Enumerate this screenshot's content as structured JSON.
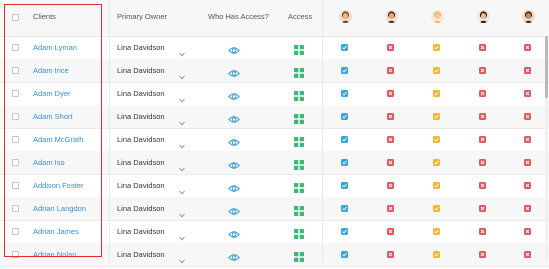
{
  "header": {
    "clients": "Clients",
    "owner": "Primary Owner",
    "who_access": "Who Has Access?",
    "access": "Access"
  },
  "avatars": [
    {
      "name": "user-avatar-1",
      "skin": "#e8b48a",
      "hair": "#6b4a2e",
      "bg": "#f2dccb"
    },
    {
      "name": "user-avatar-2",
      "skin": "#e0a985",
      "hair": "#4a2e1c",
      "bg": "#f5e0d2"
    },
    {
      "name": "user-avatar-3",
      "skin": "#f0c9a0",
      "hair": "#e1c06a",
      "bg": "#f6ead3"
    },
    {
      "name": "user-avatar-4",
      "skin": "#e7b89c",
      "hair": "#2a1c15",
      "bg": "#f6e4d9"
    },
    {
      "name": "user-avatar-5",
      "skin": "#c98b5f",
      "hair": "#3c2415",
      "bg": "#efd9c7"
    }
  ],
  "colors": {
    "check_blue": "#3aa6d8",
    "deny_red": "#e05661",
    "check_yellow": "#f2b632",
    "tiles_green": "#3cb878",
    "eye_blue": "#3a9fd0"
  },
  "rows": [
    {
      "client": "Adam Lyman",
      "owner": "Lina Davidson",
      "perms": [
        "check_blue",
        "deny_red",
        "check_yellow",
        "deny_red",
        "deny_red"
      ]
    },
    {
      "client": "Adam Ince",
      "owner": "Lina Davidson",
      "perms": [
        "check_blue",
        "deny_red",
        "check_yellow",
        "deny_red",
        "deny_red"
      ]
    },
    {
      "client": "Adam Dyer",
      "owner": "Lina Davidson",
      "perms": [
        "check_blue",
        "deny_red",
        "check_yellow",
        "deny_red",
        "deny_red"
      ]
    },
    {
      "client": "Adam Short",
      "owner": "Lina Davidson",
      "perms": [
        "check_blue",
        "deny_red",
        "check_yellow",
        "deny_red",
        "deny_red"
      ]
    },
    {
      "client": "Adam McGrath",
      "owner": "Lina Davidson",
      "perms": [
        "check_blue",
        "deny_red",
        "check_yellow",
        "deny_red",
        "deny_red"
      ]
    },
    {
      "client": "Adam Iso",
      "owner": "Lina Davidson",
      "perms": [
        "check_blue",
        "deny_red",
        "check_yellow",
        "deny_red",
        "deny_red"
      ]
    },
    {
      "client": "Addison Foster",
      "owner": "Lina Davidson",
      "perms": [
        "check_blue",
        "deny_red",
        "check_yellow",
        "deny_red",
        "deny_red"
      ]
    },
    {
      "client": "Adrian Langdon",
      "owner": "Lina Davidson",
      "perms": [
        "check_blue",
        "deny_red",
        "check_yellow",
        "deny_red",
        "deny_red"
      ]
    },
    {
      "client": "Adrian James",
      "owner": "Lina Davidson",
      "perms": [
        "check_blue",
        "deny_red",
        "check_yellow",
        "deny_red",
        "deny_red"
      ]
    },
    {
      "client": "Adrian Nolan",
      "owner": "Lina Davidson",
      "perms": [
        "check_blue",
        "deny_red",
        "check_yellow",
        "deny_red",
        "deny_red"
      ]
    }
  ]
}
